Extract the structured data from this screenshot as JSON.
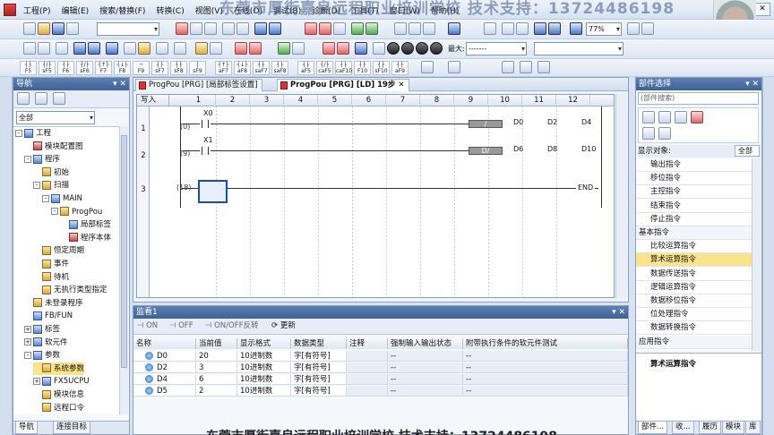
{
  "menubar": {
    "items": [
      "工程(P)",
      "编辑(E)",
      "搜索/替换(F)",
      "转换(C)",
      "视图(V)",
      "在线(O)",
      "调试(B)",
      "诊断(D)",
      "工具(T)",
      "窗口(W)",
      "帮助(H)"
    ]
  },
  "watermark": "东莞市厚街嘉良远程职业培训学校 技术支持：13724486198",
  "subtitle": "东莞市厚街嘉良远程职业培训学校 技术支持：13724486198",
  "toolbar": {
    "zoom": "77%",
    "max_label": "最大:",
    "max_value": "-------"
  },
  "fkeys": [
    {
      "sym": "┤├",
      "key": "F5"
    },
    {
      "sym": "┤/├",
      "key": "sF5"
    },
    {
      "sym": "┤├",
      "key": "F6"
    },
    {
      "sym": "┤/├",
      "key": "sF6"
    },
    {
      "sym": "┤↑├",
      "key": "F7"
    },
    {
      "sym": "┤↓├",
      "key": "F8"
    },
    {
      "sym": "─",
      "key": "F9"
    },
    {
      "sym": "┤├",
      "key": "sF7"
    },
    {
      "sym": "┤├",
      "key": "sF8"
    },
    {
      "sym": "│",
      "key": "sF9"
    },
    {
      "sym": "┤↑├",
      "key": "aF7"
    },
    {
      "sym": "┤↓├",
      "key": "aF8"
    },
    {
      "sym": "┤├",
      "key": "saF7"
    },
    {
      "sym": "┤├",
      "key": "saF8"
    },
    {
      "sym": "┤├",
      "key": "aF5"
    },
    {
      "sym": "┤/├",
      "key": "caF5"
    },
    {
      "sym": "┤├",
      "key": "caF10"
    },
    {
      "sym": "┤├",
      "key": "F10"
    },
    {
      "sym": "┤├",
      "key": "sF10"
    },
    {
      "sym": "┤├",
      "key": "aF9"
    }
  ],
  "nav": {
    "title": "导航",
    "filter": "全部",
    "tree": [
      {
        "label": "工程",
        "level": 0,
        "exp": "-",
        "icon": "blue"
      },
      {
        "label": "模块配置图",
        "level": 1,
        "exp": "",
        "icon": "red"
      },
      {
        "label": "程序",
        "level": 1,
        "exp": "-",
        "icon": "blue"
      },
      {
        "label": "初始",
        "level": 2,
        "exp": "",
        "icon": "gold"
      },
      {
        "label": "扫描",
        "level": 2,
        "exp": "-",
        "icon": "gold"
      },
      {
        "label": "MAIN",
        "level": 3,
        "exp": "-",
        "icon": "blue"
      },
      {
        "label": "ProgPou",
        "level": 4,
        "exp": "-",
        "icon": "gold"
      },
      {
        "label": "局部标签",
        "level": 5,
        "exp": "",
        "icon": "blue"
      },
      {
        "label": "程序本体",
        "level": 5,
        "exp": "",
        "icon": "red"
      },
      {
        "label": "恒定周期",
        "level": 2,
        "exp": "",
        "icon": "gold"
      },
      {
        "label": "事件",
        "level": 2,
        "exp": "",
        "icon": "gold"
      },
      {
        "label": "待机",
        "level": 2,
        "exp": "",
        "icon": "gold"
      },
      {
        "label": "无执行类型指定",
        "level": 2,
        "exp": "",
        "icon": "gold"
      },
      {
        "label": "未登录程序",
        "level": 1,
        "exp": "",
        "icon": "gold"
      },
      {
        "label": "FB/FUN",
        "level": 1,
        "exp": "",
        "icon": "blue"
      },
      {
        "label": "标签",
        "level": 1,
        "exp": "+",
        "icon": "blue"
      },
      {
        "label": "软元件",
        "level": 1,
        "exp": "+",
        "icon": "blue"
      },
      {
        "label": "参数",
        "level": 1,
        "exp": "-",
        "icon": "blue"
      },
      {
        "label": "系统参数",
        "level": 2,
        "exp": "",
        "icon": "gold",
        "selected": true
      },
      {
        "label": "FX5UCPU",
        "level": 2,
        "exp": "+",
        "icon": "blue"
      },
      {
        "label": "模块信息",
        "level": 2,
        "exp": "",
        "icon": "gold"
      },
      {
        "label": "远程口令",
        "level": 2,
        "exp": "",
        "icon": "gold"
      }
    ],
    "tabs": [
      "导航",
      "连接目标"
    ]
  },
  "editor": {
    "tabs": [
      {
        "label": "ProgPou [PRG] [局部标签设置]",
        "active": false
      },
      {
        "label": "ProgPou [PRG] [LD] 19步",
        "active": true
      }
    ],
    "write_mode": "写入",
    "columns": [
      "1",
      "2",
      "3",
      "4",
      "5",
      "6",
      "7",
      "8",
      "9",
      "10",
      "11",
      "12"
    ],
    "rungs": [
      {
        "row": "1",
        "step": "(0)",
        "device": "X0",
        "func": "/",
        "ops": [
          "D0",
          "D2",
          "D4"
        ]
      },
      {
        "row": "2",
        "step": "(9)",
        "device": "X1",
        "func": "D/",
        "ops": [
          "D6",
          "D8",
          "D10"
        ]
      },
      {
        "row": "3",
        "step": "(18)",
        "end": "END"
      }
    ]
  },
  "monitor": {
    "title": "监看1",
    "buttons": [
      "ON",
      "OFF",
      "ON/OFF反转",
      "更新"
    ],
    "headers": [
      "名称",
      "当前值",
      "显示格式",
      "数据类型",
      "注释",
      "强制输入输出状态",
      "附带执行条件的软元件测试"
    ],
    "rows": [
      {
        "name": "D0",
        "value": "20",
        "fmt": "10进制数",
        "type": "字[有符号]",
        "comment": "",
        "force": "--",
        "test": "--"
      },
      {
        "name": "D2",
        "value": "3",
        "fmt": "10进制数",
        "type": "字[有符号]",
        "comment": "",
        "force": "--",
        "test": "--"
      },
      {
        "name": "D4",
        "value": "6",
        "fmt": "10进制数",
        "type": "字[有符号]",
        "comment": "",
        "force": "--",
        "test": "--"
      },
      {
        "name": "D5",
        "value": "2",
        "fmt": "10进制数",
        "type": "字[有符号]",
        "comment": "",
        "force": "--",
        "test": "--"
      }
    ]
  },
  "parts": {
    "title": "部件选择",
    "search_placeholder": "(部件搜索)",
    "display_label": "显示对象:",
    "display_value": "全部",
    "categories": [
      {
        "label": "输出指令",
        "type": "item"
      },
      {
        "label": "移位指令",
        "type": "item"
      },
      {
        "label": "主控指令",
        "type": "item"
      },
      {
        "label": "结束指令",
        "type": "item"
      },
      {
        "label": "停止指令",
        "type": "item"
      },
      {
        "label": "基本指令",
        "type": "grp"
      },
      {
        "label": "比较运算指令",
        "type": "item"
      },
      {
        "label": "算术运算指令",
        "type": "item",
        "selected": true
      },
      {
        "label": "数据传送指令",
        "type": "item"
      },
      {
        "label": "逻辑运算指令",
        "type": "item"
      },
      {
        "label": "数据移位指令",
        "type": "item"
      },
      {
        "label": "位处理指令",
        "type": "item"
      },
      {
        "label": "数据转换指令",
        "type": "item"
      },
      {
        "label": "应用指令",
        "type": "grp"
      }
    ],
    "description": "算术运算指令",
    "tabs": [
      "部件...",
      "收...",
      "履历",
      "模块",
      "库"
    ]
  }
}
